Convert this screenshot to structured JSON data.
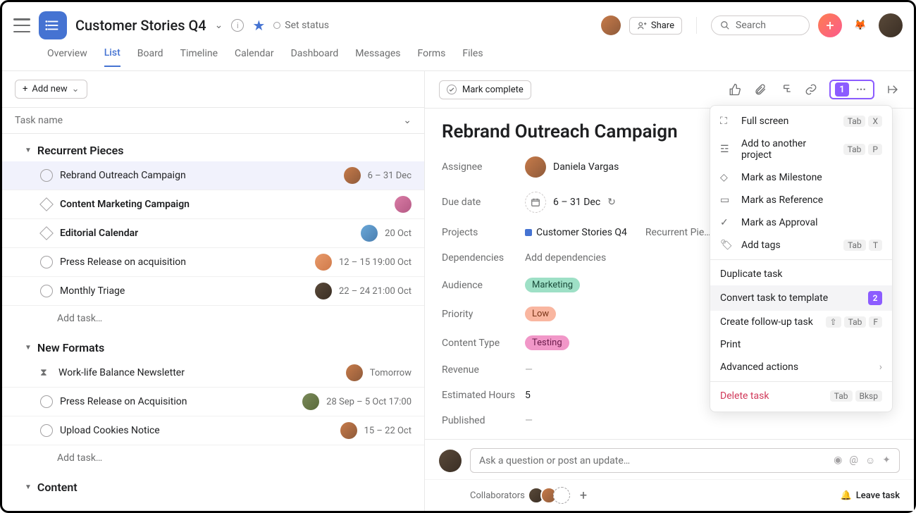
{
  "header": {
    "project_title": "Customer Stories Q4",
    "set_status": "Set status",
    "share": "Share",
    "search_placeholder": "Search"
  },
  "tabs": [
    "Overview",
    "List",
    "Board",
    "Timeline",
    "Calendar",
    "Dashboard",
    "Messages",
    "Forms",
    "Files"
  ],
  "active_tab": "List",
  "addnew": "Add new",
  "column_header": "Task name",
  "sections": [
    {
      "title": "Recurrent Pieces",
      "tasks": [
        {
          "name": "Rebrand Outreach Campaign",
          "date": "6 – 31 Dec",
          "icon": "check",
          "selected": true,
          "bold": false,
          "av": "av-a"
        },
        {
          "name": "Content Marketing Campaign",
          "date": "",
          "icon": "diamond",
          "bold": true,
          "av": "av-b"
        },
        {
          "name": "Editorial Calendar",
          "date": "20 Oct",
          "icon": "diamond",
          "bold": true,
          "av": "av-c"
        },
        {
          "name": "Press Release on acquisition",
          "date": "12 – 15 19:00 Oct",
          "icon": "check",
          "bold": false,
          "av": "av-e"
        },
        {
          "name": "Monthly Triage",
          "date": "22 – 24 21:00 Oct",
          "icon": "check",
          "bold": false,
          "av": "av-d"
        }
      ]
    },
    {
      "title": "New Formats",
      "tasks": [
        {
          "name": "Work-life Balance Newsletter",
          "date": "Tomorrow",
          "icon": "hourglass",
          "bold": false,
          "av": "av-a"
        },
        {
          "name": "Press Release on Acquisition",
          "date": "28 Sep – 5 Oct 17:00",
          "icon": "check",
          "bold": false,
          "av": "av-f"
        },
        {
          "name": "Upload Cookies Notice",
          "date": "15 – 22 Oct",
          "icon": "check",
          "bold": false,
          "av": "av-a"
        }
      ]
    },
    {
      "title": "Content",
      "tasks": []
    }
  ],
  "addtask": "Add task…",
  "panel": {
    "mark_complete": "Mark complete",
    "title": "Rebrand Outreach Campaign",
    "assignee_label": "Assignee",
    "assignee": "Daniela Vargas",
    "due_label": "Due date",
    "due": "6 – 31 Dec",
    "projects_label": "Projects",
    "project1": "Customer Stories Q4",
    "project2": "Recurrent Pie…",
    "dep_label": "Dependencies",
    "dep_val": "Add dependencies",
    "audience_label": "Audience",
    "audience_val": "Marketing",
    "audience_color": "#5da283",
    "priority_label": "Priority",
    "priority_val": "Low",
    "priority_color": "#f58e6f",
    "content_label": "Content Type",
    "content_val": "Testing",
    "content_color": "#e362a6",
    "revenue_label": "Revenue",
    "est_label": "Estimated Hours",
    "est_val": "5",
    "pub_label": "Published",
    "comment_placeholder": "Ask a question or post an update…",
    "collab_label": "Collaborators",
    "leave": "Leave task"
  },
  "menu": {
    "step1": "1",
    "step2": "2",
    "items1": [
      {
        "icon": "⛶",
        "label": "Full screen",
        "keys": [
          "Tab",
          "X"
        ]
      },
      {
        "icon": "☲",
        "label": "Add to another project",
        "keys": [
          "Tab",
          "P"
        ]
      },
      {
        "icon": "◇",
        "label": "Mark as Milestone"
      },
      {
        "icon": "▭",
        "label": "Mark as Reference"
      },
      {
        "icon": "✓",
        "label": "Mark as Approval"
      },
      {
        "icon": "🏷",
        "label": "Add tags",
        "keys": [
          "Tab",
          "T"
        ]
      }
    ],
    "items2": [
      {
        "label": "Duplicate task"
      },
      {
        "label": "Convert task to template",
        "hl": true,
        "badge": "2"
      },
      {
        "label": "Create follow-up task",
        "keys": [
          "⇧",
          "Tab",
          "F"
        ]
      },
      {
        "label": "Print"
      },
      {
        "label": "Advanced actions",
        "chev": true
      }
    ],
    "delete": {
      "label": "Delete task",
      "keys": [
        "Tab",
        "Bksp"
      ]
    }
  }
}
